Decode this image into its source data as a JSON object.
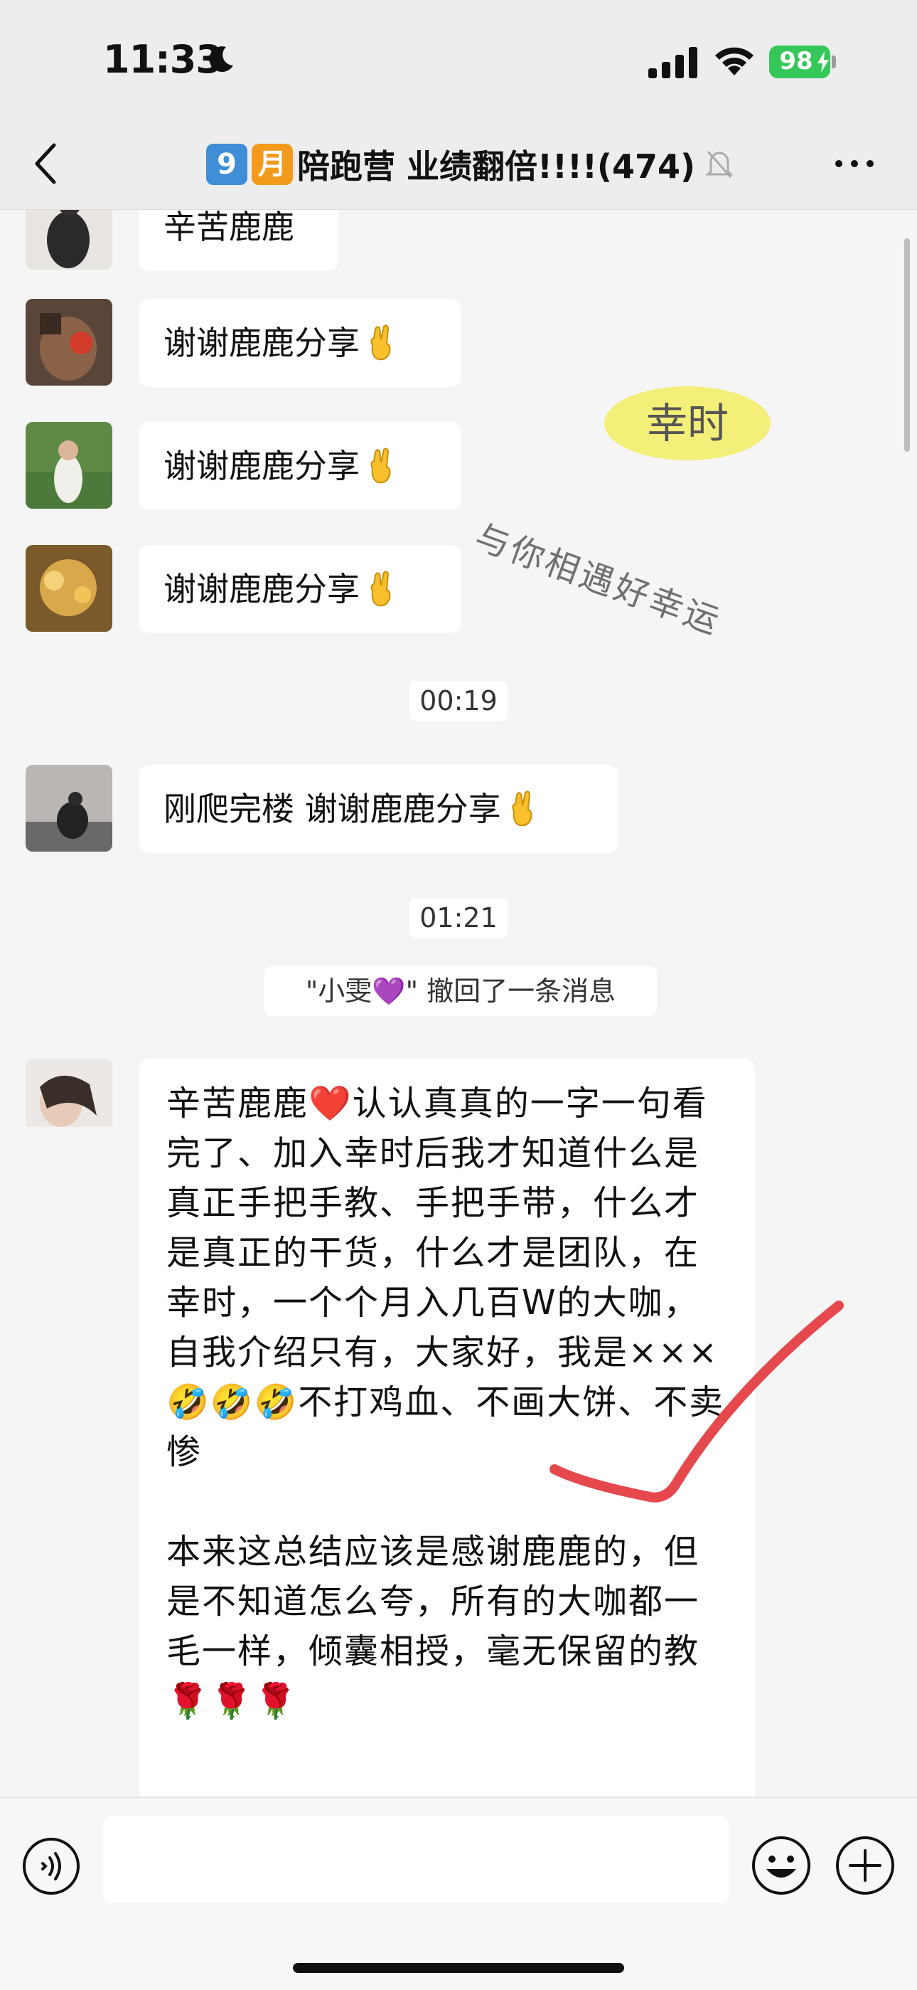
{
  "status_bar": {
    "time": "11:33",
    "battery": "98",
    "icons": [
      "moon-icon",
      "signal-icon",
      "wifi-icon",
      "battery-icon"
    ]
  },
  "nav": {
    "title_emoji_1": "9",
    "title_emoji_2": "月",
    "title_text": "陪跑营 业绩翻倍!!!!(474)",
    "icons": [
      "back-icon",
      "mute-icon",
      "more-icon"
    ]
  },
  "chat": {
    "messages": [
      {
        "text": "辛苦鹿鹿"
      },
      {
        "text": "谢谢鹿鹿分享"
      },
      {
        "text": "谢谢鹿鹿分享"
      },
      {
        "text": "谢谢鹿鹿分享"
      },
      {
        "text": "刚爬完楼 谢谢鹿鹿分享"
      }
    ],
    "timestamps": [
      "00:19",
      "01:21"
    ],
    "recall_notice": "\"小雯💜\" 撤回了一条消息",
    "long_message": {
      "para1": "辛苦鹿鹿❤️认认真真的一字一句看完了、加入幸时后我才知道什么是真正手把手教、手把手带，什么才是真正的干货，什么才是团队，在幸时，一个个月入几百W的大咖，自我介绍只有，大家好，我是×××🤣🤣🤣不打鸡血、不画大饼、不卖惨",
      "para2": "本来这总结应该是感谢鹿鹿的，但是不知道怎么夸，所有的大咖都一毛一样，倾囊相授，毫无保留的教🌹🌹🌹"
    }
  },
  "stickers": {
    "oval_text": "幸时",
    "slogan": "与你相遇好幸运"
  },
  "input_bar": {
    "placeholder": "",
    "icons": [
      "voice-icon",
      "emoji-icon",
      "plus-icon"
    ]
  },
  "colors": {
    "background": "#f5f5f5",
    "bubble": "#ffffff",
    "battery": "#35c759",
    "check_mark": "#e5484d",
    "sticker": "#f3ef78"
  }
}
